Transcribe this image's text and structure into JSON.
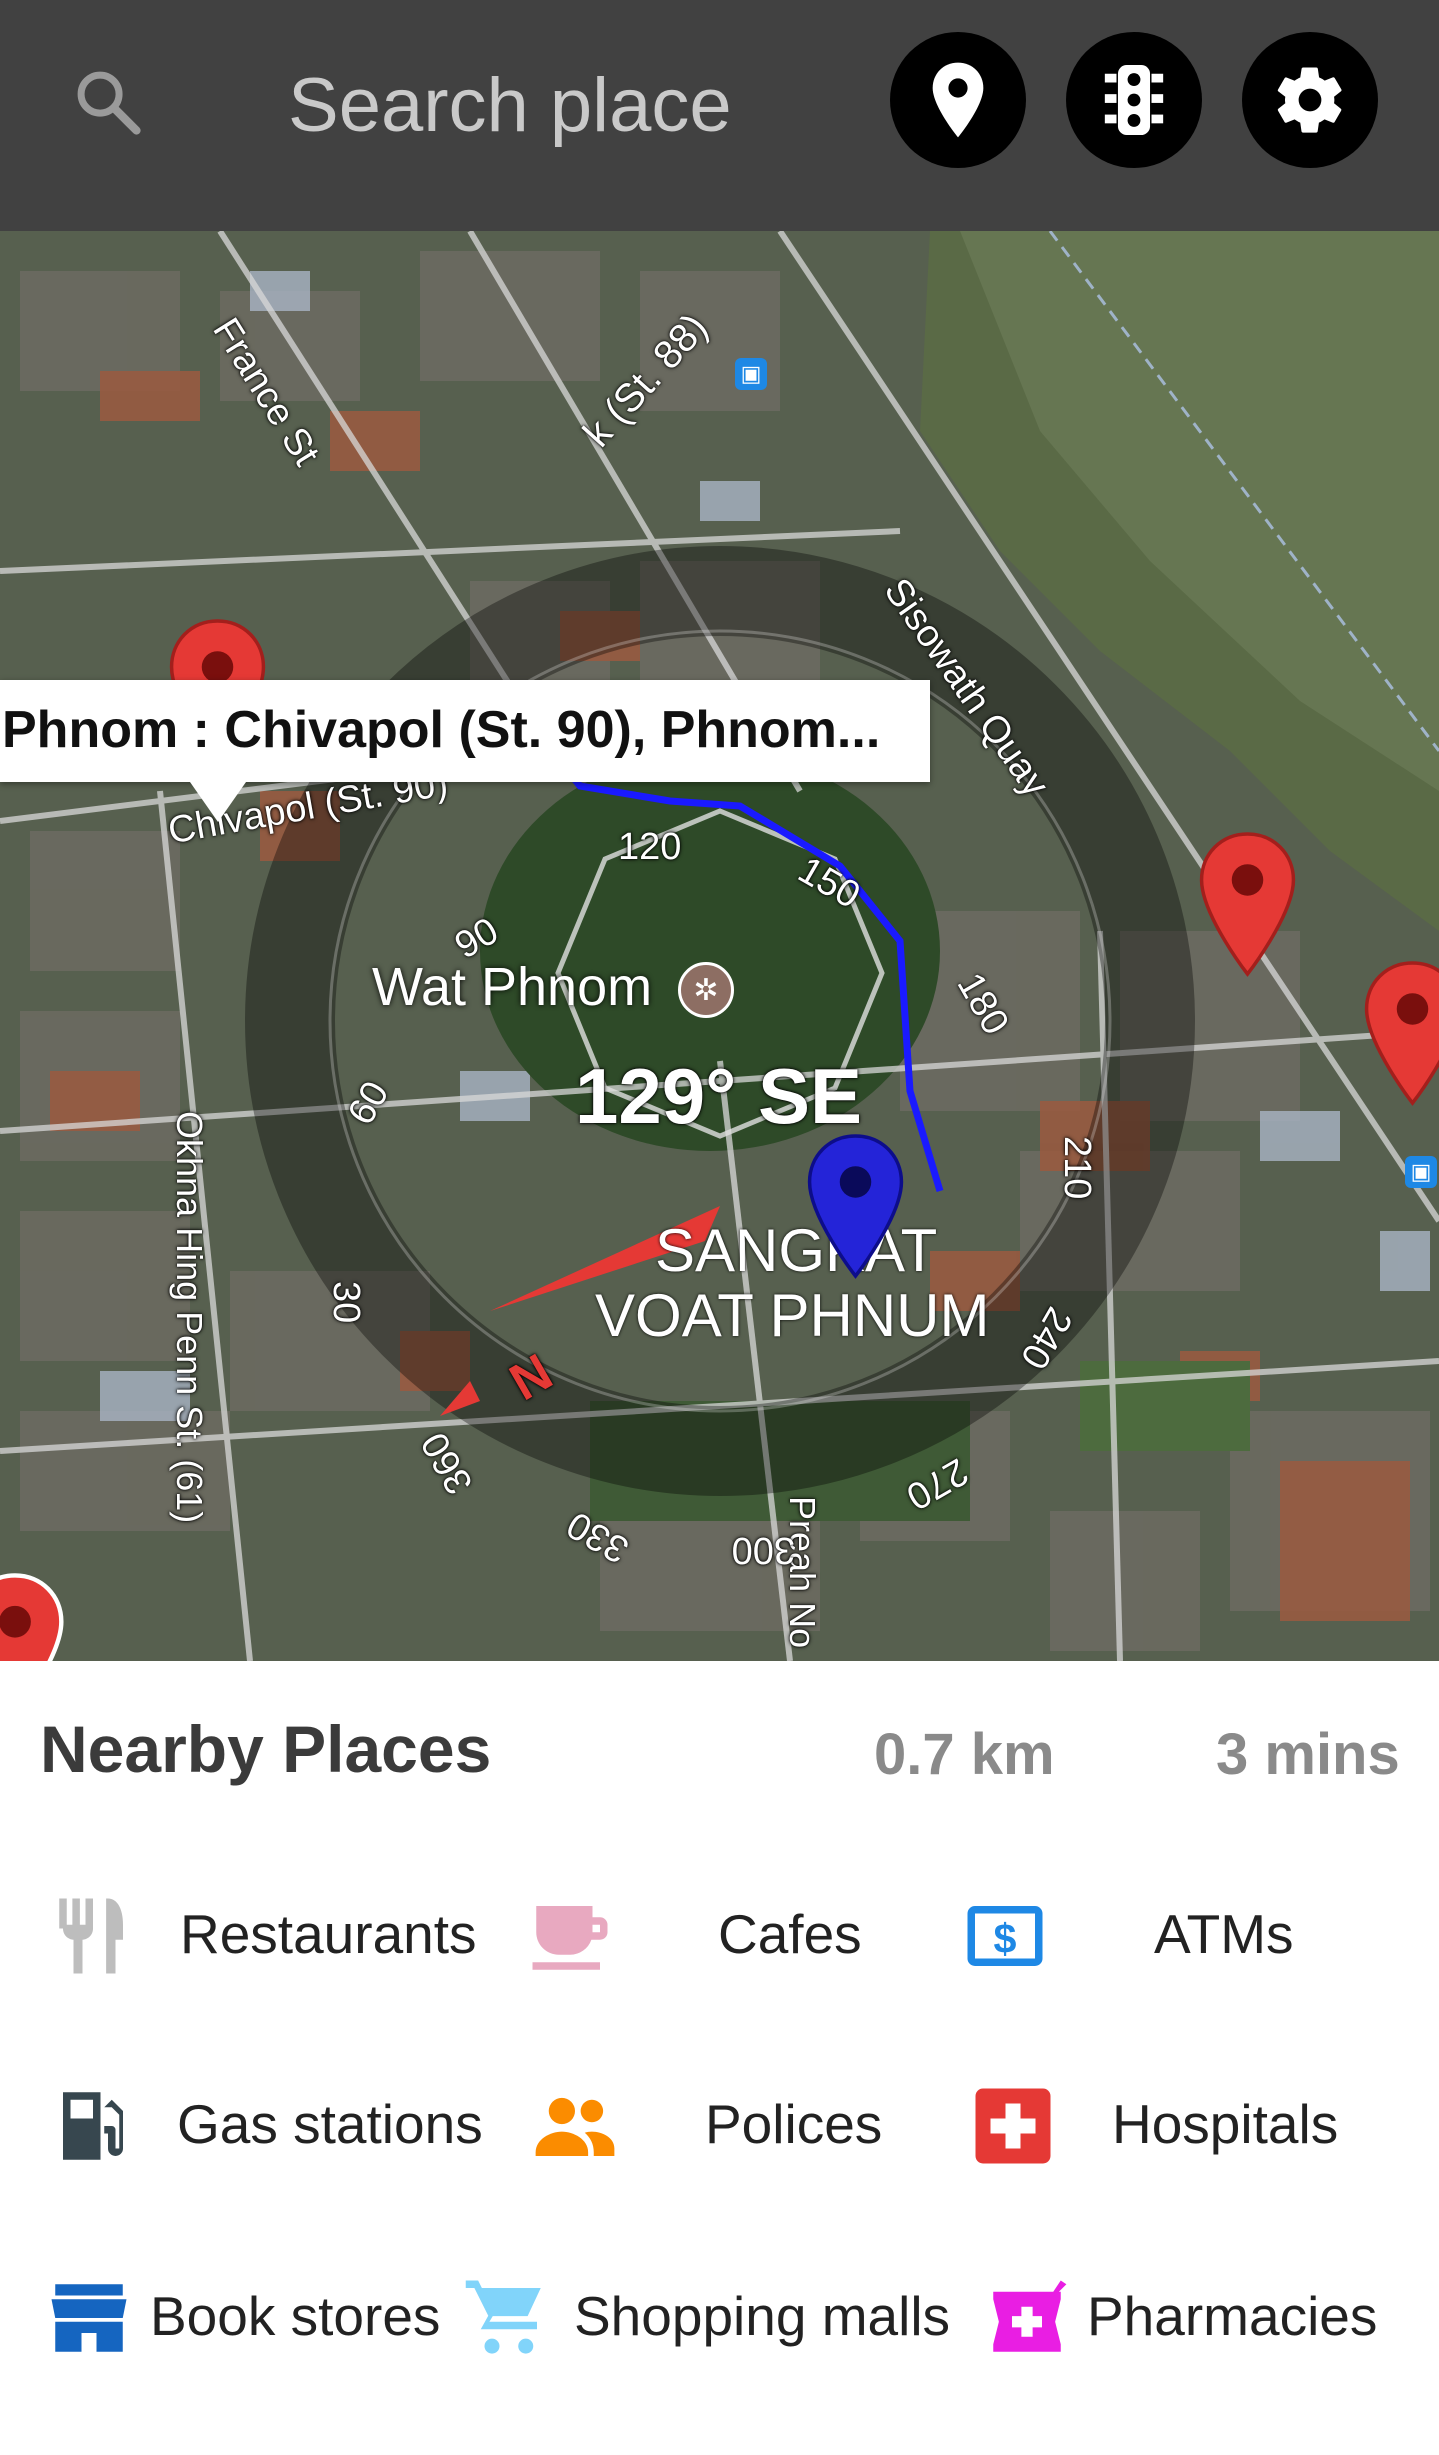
{
  "search": {
    "placeholder": "Search place"
  },
  "toolbar": {
    "location_icon": "location-pin-icon",
    "traffic_icon": "traffic-light-icon",
    "settings_icon": "gear-icon"
  },
  "map": {
    "info_window": "Phnom : Chivapol (St. 90), Phnom...",
    "streets": [
      "France St",
      "k (St. 88)",
      "Sisowath Quay",
      "Chivapol (St. 90)",
      "Okhna Hing Penn St. (61)",
      "Preah No"
    ],
    "landmark": "Wat Phnom",
    "area_label_line1": "SANGKAT",
    "area_label_line2": "VOAT PHNUM",
    "compass": {
      "heading": "129° SE",
      "north_marker": "N",
      "ticks": [
        "120",
        "150",
        "180",
        "210",
        "240",
        "270",
        "300",
        "330",
        "360",
        "30",
        "60",
        "90"
      ]
    },
    "colors": {
      "route": "#1a1aff",
      "marker": "#e53935",
      "current_marker": "#2424d8"
    }
  },
  "nearby": {
    "title": "Nearby Places",
    "distance": "0.7 km",
    "duration": "3 mins",
    "categories": [
      {
        "label": "Restaurants",
        "icon": "restaurant-icon",
        "color": "#bdbdbd"
      },
      {
        "label": "Cafes",
        "icon": "cafe-icon",
        "color": "#e8a9c0"
      },
      {
        "label": "ATMs",
        "icon": "atm-icon",
        "color": "#1e88e5"
      },
      {
        "label": "Gas stations",
        "icon": "gas-station-icon",
        "color": "#37474f"
      },
      {
        "label": "Polices",
        "icon": "police-icon",
        "color": "#fb8c00"
      },
      {
        "label": "Hospitals",
        "icon": "hospital-icon",
        "color": "#e53935"
      },
      {
        "label": "Book stores",
        "icon": "book-store-icon",
        "color": "#1565c0"
      },
      {
        "label": "Shopping malls",
        "icon": "shopping-cart-icon",
        "color": "#81d4fa"
      },
      {
        "label": "Pharmacies",
        "icon": "pharmacy-icon",
        "color": "#e91ee3"
      }
    ]
  }
}
